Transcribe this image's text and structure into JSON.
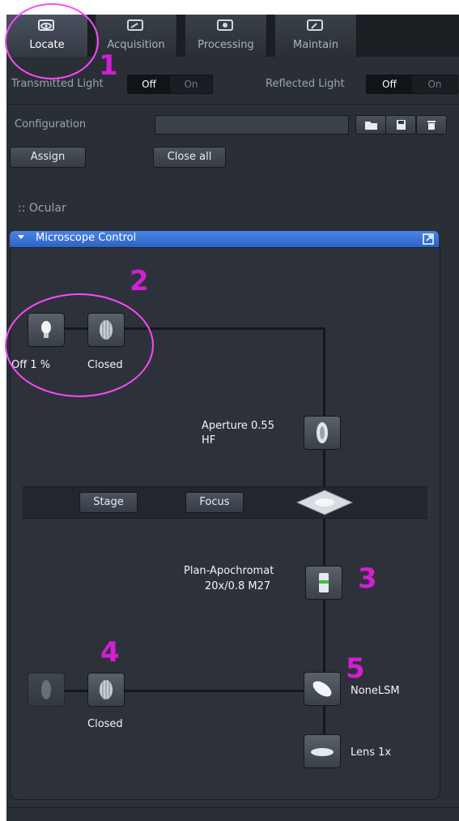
{
  "tabs": [
    {
      "label": "Locate",
      "icon": "eye-icon",
      "active": true
    },
    {
      "label": "Acquisition",
      "icon": "acquisition-icon",
      "active": false
    },
    {
      "label": "Processing",
      "icon": "gear-icon",
      "active": false
    },
    {
      "label": "Maintain",
      "icon": "wrench-icon",
      "active": false
    }
  ],
  "light": {
    "transmitted_label": "Transmitted Light",
    "reflected_label": "Reflected Light",
    "off": "Off",
    "on": "On"
  },
  "configuration": {
    "label": "Configuration",
    "value": "",
    "assign": "Assign",
    "close_all": "Close all"
  },
  "ocular_label": ":: Ocular",
  "microscope_control": {
    "title": "Microscope Control",
    "lamp_status": "Off 1 %",
    "shutter_status": "Closed",
    "aperture_line1": "Aperture 0.55",
    "aperture_line2": "HF",
    "stage_button": "Stage",
    "focus_button": "Focus",
    "objective_line1": "Plan-Apochromat",
    "objective_line2": "20x/0.8 M27",
    "reflector_shutter_status": "Closed",
    "reflector_label": "NoneLSM",
    "lens_label": "Lens 1x"
  },
  "annotations": [
    "1",
    "2",
    "3",
    "4",
    "5"
  ],
  "colors": {
    "accent_blue": "#2d62c4",
    "annotation_magenta": "#d21fd2",
    "ring": "#ff47ff"
  }
}
